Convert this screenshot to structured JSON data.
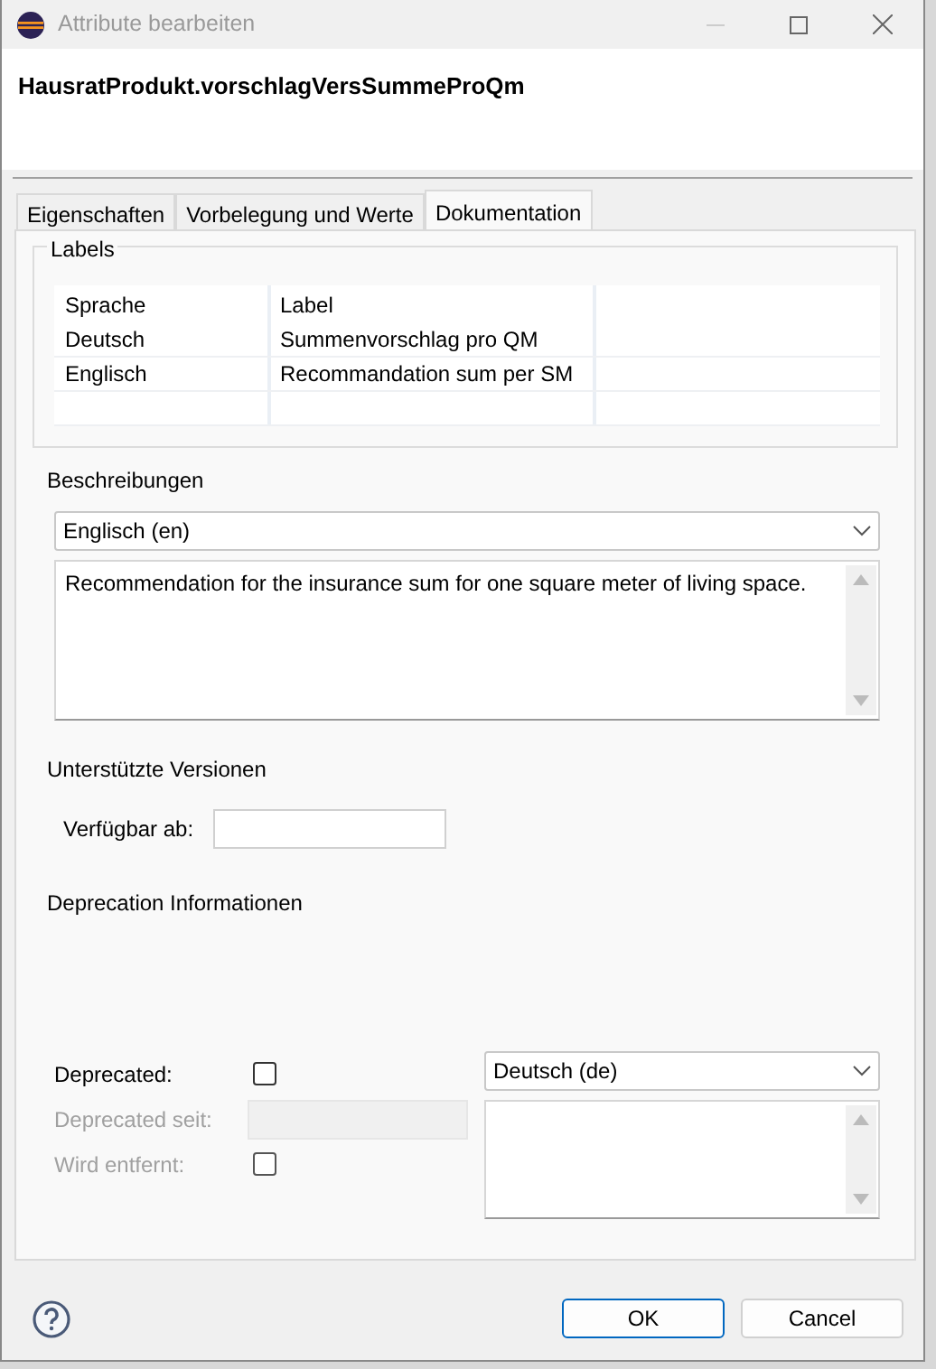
{
  "window": {
    "title": "Attribute bearbeiten"
  },
  "header": {
    "title": "HausratProdukt.vorschlagVersSummeProQm"
  },
  "tabs": [
    {
      "label": "Eigenschaften",
      "selected": false
    },
    {
      "label": "Vorbelegung und Werte",
      "selected": false
    },
    {
      "label": "Dokumentation",
      "selected": true
    }
  ],
  "labels_group": {
    "title": "Labels",
    "columns": [
      "Sprache",
      "Label"
    ],
    "rows": [
      [
        "Deutsch",
        "Summenvorschlag pro QM"
      ],
      [
        "Englisch",
        "Recommandation sum per SM"
      ]
    ]
  },
  "descriptions": {
    "title": "Beschreibungen",
    "language": "Englisch (en)",
    "text": "Recommendation for the insurance sum for one square meter of living space."
  },
  "versions": {
    "title": "Unterstützte Versionen",
    "field_label": "Verfügbar ab:"
  },
  "deprecation": {
    "title": "Deprecation Informationen",
    "language": "Deutsch (de)",
    "items": [
      {
        "kind": "checkbox",
        "label": "Deprecated:",
        "checked": false,
        "disabled": false
      },
      {
        "kind": "field",
        "label": "Deprecated seit:",
        "disabled": true
      },
      {
        "kind": "checkbox",
        "label": "Wird entfernt:",
        "checked": false,
        "disabled": true
      }
    ]
  },
  "buttons": [
    {
      "label": "OK",
      "default": true
    },
    {
      "label": "Cancel",
      "default": false
    }
  ]
}
